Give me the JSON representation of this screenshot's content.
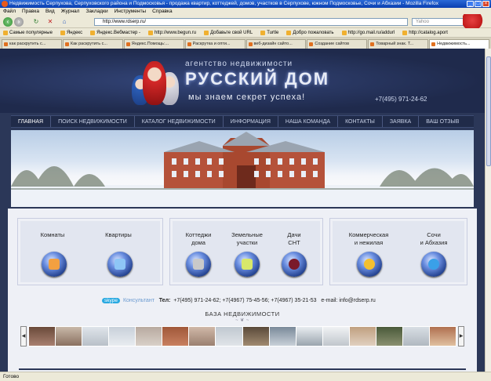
{
  "window": {
    "title": "Недвижимость Серпухова, Серпуховского района и Подмосковья - продажа квартир, коттеджей, домов, участков в Серпухове, южном Подмосковье, Сочи и Абхазии - Mozilla Firefox"
  },
  "menubar": [
    "Файл",
    "Правка",
    "Вид",
    "Журнал",
    "Закладки",
    "Инструменты",
    "Справка"
  ],
  "toolbar": {
    "url": "http://www.rdserp.ru/",
    "search_placeholder": "Yahoo"
  },
  "bookmarks": [
    "Самые популярные",
    "Яндекс",
    "Яндекс.Вебмастер -",
    "http://www.begun.ru",
    "Добавьте свой URL",
    "Turtle",
    "Добро пожаловать",
    "http://go.mail.ru/addurl",
    "http://catalog.aport"
  ],
  "tabs": [
    "как раскрутить с...",
    "Как раскрутить с...",
    "Яндекс.Помощь:...",
    "Раскрутка и опти...",
    "веб-дизайн сайто...",
    "Создание сайтов",
    "Товарный знак. Т...",
    "Недвижимость..."
  ],
  "header": {
    "top": "агентство недвижимости",
    "main": "РУССКИЙ ДОМ",
    "sub": "мы знаем секрет успеха!",
    "phone": "+7(495) 971-24-62"
  },
  "menu": [
    "ГЛАВНАЯ",
    "ПОИСК НЕДВИЖИМОСТИ",
    "КАТАЛОГ НЕДВИЖИМОСТИ",
    "ИНФОРМАЦИЯ",
    "НАША КОМАНДА",
    "КОНТАКТЫ",
    "ЗАЯВКА",
    "ВАШ ОТЗЫВ"
  ],
  "categories": [
    {
      "label": "Комнаты"
    },
    {
      "label": "Квартиры"
    },
    {
      "label": "Коттеджи\nдома"
    },
    {
      "label": "Земельные\nучастки"
    },
    {
      "label": "Дачи\nСНТ"
    },
    {
      "label": "Коммерческая\nи нежилая"
    },
    {
      "label": "Сочи\nи Абхазия"
    }
  ],
  "contacts": {
    "skype": "skype",
    "consultant": "Консультант",
    "tel_label": "Тел:",
    "phones": "+7(495) 971-24-62;   +7(4967) 75-45-56;  +7(4967) 35-21-53",
    "email_label": "e-mail:",
    "email": "info@rdserp.ru"
  },
  "baza": {
    "title": "БАЗА НЕДВИЖИМОСТИ"
  },
  "status": {
    "text": "Готово"
  }
}
